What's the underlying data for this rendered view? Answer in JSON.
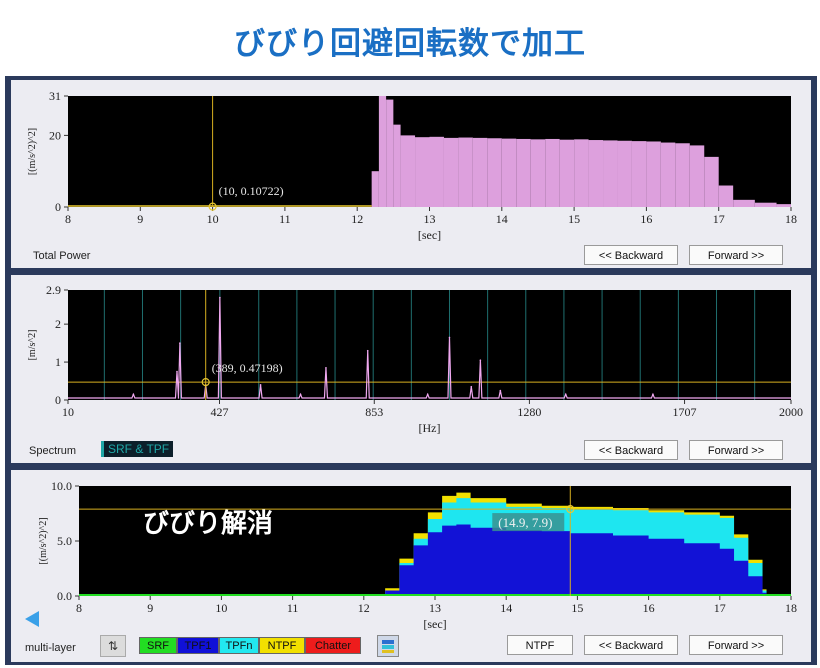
{
  "title": "びびり回避回転数で加工",
  "panel1": {
    "caption": "Total Power",
    "ylabel": "[(m/s^2)^2]",
    "xlabel": "[sec]",
    "marker_label": "(10, 0.10722)",
    "btn_backward": "<< Backward",
    "btn_forward": "Forward >>"
  },
  "panel2": {
    "caption": "Spectrum",
    "tag": "SRF & TPF",
    "ylabel": "[m/s^2]",
    "xlabel": "[Hz]",
    "marker_label": "(389, 0.47198)",
    "btn_backward": "<< Backward",
    "btn_forward": "Forward >>"
  },
  "panel3": {
    "caption": "multi-layer",
    "overlay": "びびり解消",
    "ylabel": "[(m/s^2)^2]",
    "xlabel": "[sec]",
    "marker_label": "(14.9, 7.9)",
    "sort_icon": "⇅",
    "layers": [
      {
        "label": "SRF",
        "bg": "#22dd22",
        "fg": "#111111"
      },
      {
        "label": "TPF1",
        "bg": "#1010d8",
        "fg": "#111111"
      },
      {
        "label": "TPFn",
        "bg": "#22e8f0",
        "fg": "#111111"
      },
      {
        "label": "NTPF",
        "bg": "#f2e000",
        "fg": "#111111"
      },
      {
        "label": "Chatter",
        "bg": "#ee1c1c",
        "fg": "#111111"
      }
    ],
    "btn_ntpf": "NTPF",
    "btn_backward": "<< Backward",
    "btn_forward": "Forward >>"
  },
  "chart_data": [
    {
      "type": "bar",
      "name": "Total Power",
      "xlabel": "[sec]",
      "ylabel": "[(m/s^2)^2]",
      "xlim": [
        8,
        18
      ],
      "ylim": [
        0,
        31
      ],
      "xticks": [
        "8",
        "9",
        "10",
        "11",
        "12",
        "13",
        "14",
        "15",
        "16",
        "17",
        "18"
      ],
      "yticks": [
        "0",
        "20",
        "31"
      ],
      "marker": {
        "x": 10,
        "y": 0.10722
      },
      "color": "#dda0dd",
      "x": [
        12.2,
        12.3,
        12.4,
        12.5,
        12.6,
        12.8,
        13.0,
        13.2,
        13.4,
        13.6,
        13.8,
        14.0,
        14.2,
        14.4,
        14.6,
        14.8,
        15.0,
        15.2,
        15.4,
        15.6,
        15.8,
        16.0,
        16.2,
        16.4,
        16.6,
        16.8,
        17.0,
        17.2,
        17.5,
        17.8
      ],
      "values": [
        10,
        31,
        30,
        23,
        20,
        19.5,
        19.6,
        19.3,
        19.4,
        19.3,
        19.2,
        19.1,
        19,
        18.9,
        19,
        18.8,
        18.9,
        18.7,
        18.6,
        18.5,
        18.4,
        18.3,
        18,
        17.8,
        17.2,
        14,
        6,
        2,
        1.2,
        0.8
      ]
    },
    {
      "type": "line",
      "name": "Spectrum",
      "xlabel": "[Hz]",
      "ylabel": "[m/s^2]",
      "xlim": [
        10,
        2000
      ],
      "ylim": [
        0,
        2.9
      ],
      "xticks": [
        "10",
        "427",
        "853",
        "1280",
        "1707",
        "2000"
      ],
      "yticks": [
        "0",
        "1",
        "2",
        "2.9"
      ],
      "marker": {
        "x": 389,
        "y": 0.47198
      },
      "threshold": 0.47198,
      "color": "#f0a8f0",
      "peaks": [
        {
          "x": 190,
          "y": 0.15
        },
        {
          "x": 310,
          "y": 0.75
        },
        {
          "x": 318,
          "y": 1.5
        },
        {
          "x": 389,
          "y": 0.4
        },
        {
          "x": 428,
          "y": 2.7
        },
        {
          "x": 540,
          "y": 0.4
        },
        {
          "x": 650,
          "y": 0.15
        },
        {
          "x": 720,
          "y": 0.85
        },
        {
          "x": 835,
          "y": 1.3
        },
        {
          "x": 1000,
          "y": 0.15
        },
        {
          "x": 1060,
          "y": 1.65
        },
        {
          "x": 1120,
          "y": 0.35
        },
        {
          "x": 1145,
          "y": 1.05
        },
        {
          "x": 1200,
          "y": 0.25
        },
        {
          "x": 1380,
          "y": 0.15
        },
        {
          "x": 1620,
          "y": 0.15
        }
      ],
      "harmonic_lines": [
        110,
        215,
        320,
        428,
        535,
        640,
        745,
        850,
        955,
        1060,
        1165,
        1270,
        1375,
        1480,
        1585,
        1690,
        1795,
        1900
      ]
    },
    {
      "type": "area",
      "name": "multi-layer",
      "xlabel": "[sec]",
      "ylabel": "[(m/s^2)^2]",
      "xlim": [
        8,
        18
      ],
      "ylim": [
        0,
        10
      ],
      "xticks": [
        "8",
        "9",
        "10",
        "11",
        "12",
        "13",
        "14",
        "15",
        "16",
        "17",
        "18"
      ],
      "yticks": [
        "0.0",
        "5.0",
        "10.0"
      ],
      "marker": {
        "x": 14.9,
        "y": 7.9
      },
      "threshold": 7.9,
      "x": [
        12.3,
        12.5,
        12.7,
        12.9,
        13.1,
        13.3,
        13.5,
        14.0,
        14.5,
        14.9,
        15.5,
        16.0,
        16.5,
        17.0,
        17.2,
        17.4,
        17.6
      ],
      "series": [
        {
          "name": "TPF1",
          "color": "#1212d6",
          "values": [
            0.5,
            2.8,
            4.6,
            5.8,
            6.4,
            6.5,
            6.2,
            6.0,
            5.9,
            5.7,
            5.5,
            5.2,
            4.8,
            4.3,
            3.2,
            1.8,
            0.3
          ]
        },
        {
          "name": "TPFn",
          "color": "#1ee6f0",
          "values": [
            0.5,
            3.0,
            5.2,
            7.0,
            8.5,
            8.9,
            8.5,
            8.1,
            8.0,
            7.9,
            7.8,
            7.6,
            7.4,
            7.1,
            5.3,
            3.0,
            0.5
          ]
        },
        {
          "name": "NTPF",
          "color": "#f2e000",
          "values": [
            0.7,
            3.4,
            5.7,
            7.6,
            9.1,
            9.4,
            8.9,
            8.4,
            8.2,
            8.1,
            8.0,
            7.8,
            7.6,
            7.3,
            5.6,
            3.3,
            0.6
          ]
        },
        {
          "name": "SRF",
          "color": "#22dd22",
          "values": [
            0.1,
            0.1,
            0.1,
            0.1,
            0.1,
            0.1,
            0.1,
            0.1,
            0.1,
            0.1,
            0.1,
            0.1,
            0.1,
            0.1,
            0.1,
            0.1,
            0.1
          ]
        }
      ]
    }
  ]
}
